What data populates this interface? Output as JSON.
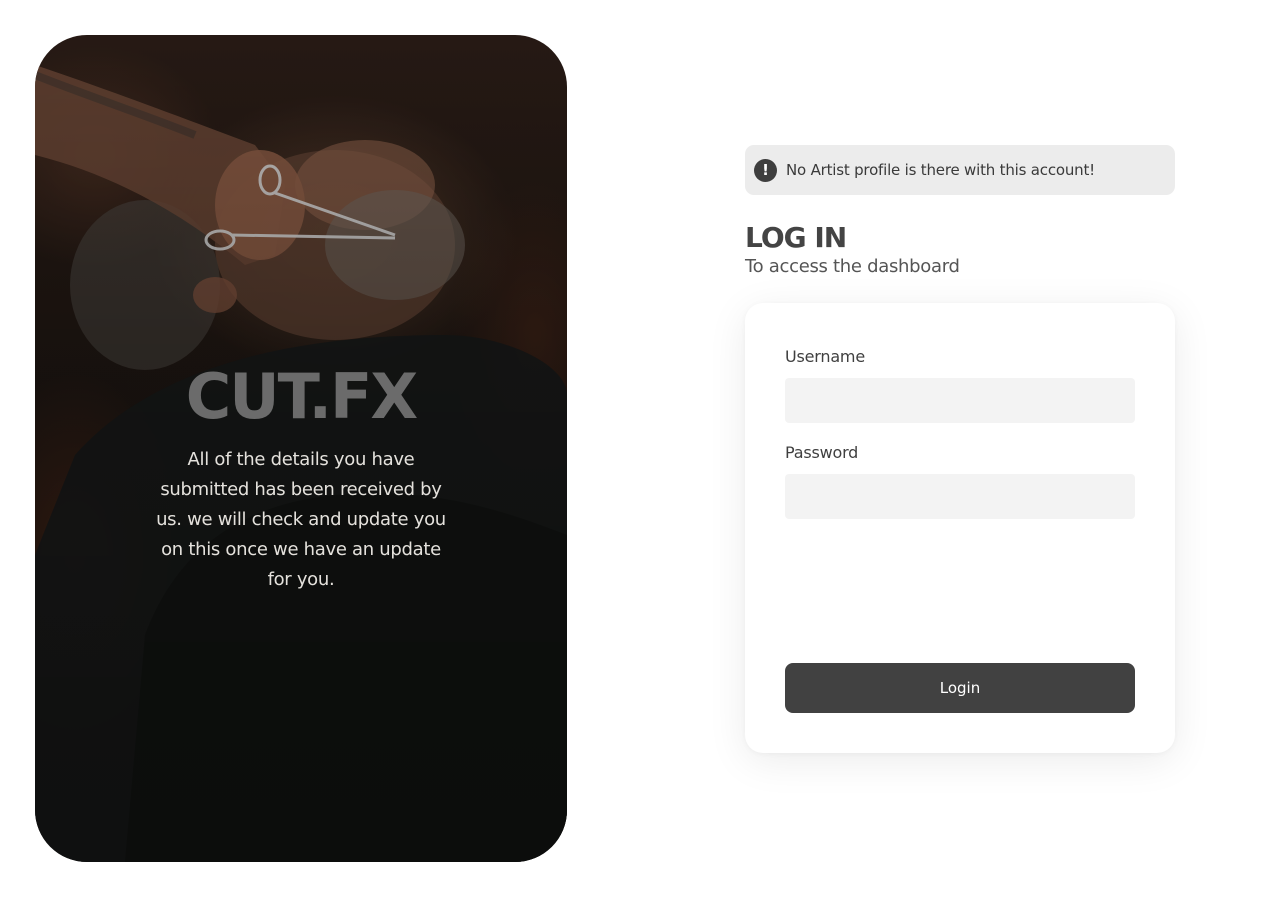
{
  "hero": {
    "brand": "CUT.FX",
    "message": "All of the details you have submitted has been received by us. we will check and update you on this once we have an update for you."
  },
  "alert": {
    "icon": "exclamation-circle-icon",
    "icon_glyph": "!",
    "text": "No Artist profile is there with this account!"
  },
  "login": {
    "title": "LOG IN",
    "subtitle": "To access the dashboard",
    "username_label": "Username",
    "username_value": "",
    "password_label": "Password",
    "password_value": "",
    "button_label": "Login"
  },
  "colors": {
    "button": "#414141",
    "alert_background": "#ececec",
    "input_background": "#f3f3f3",
    "title": "#444444"
  }
}
